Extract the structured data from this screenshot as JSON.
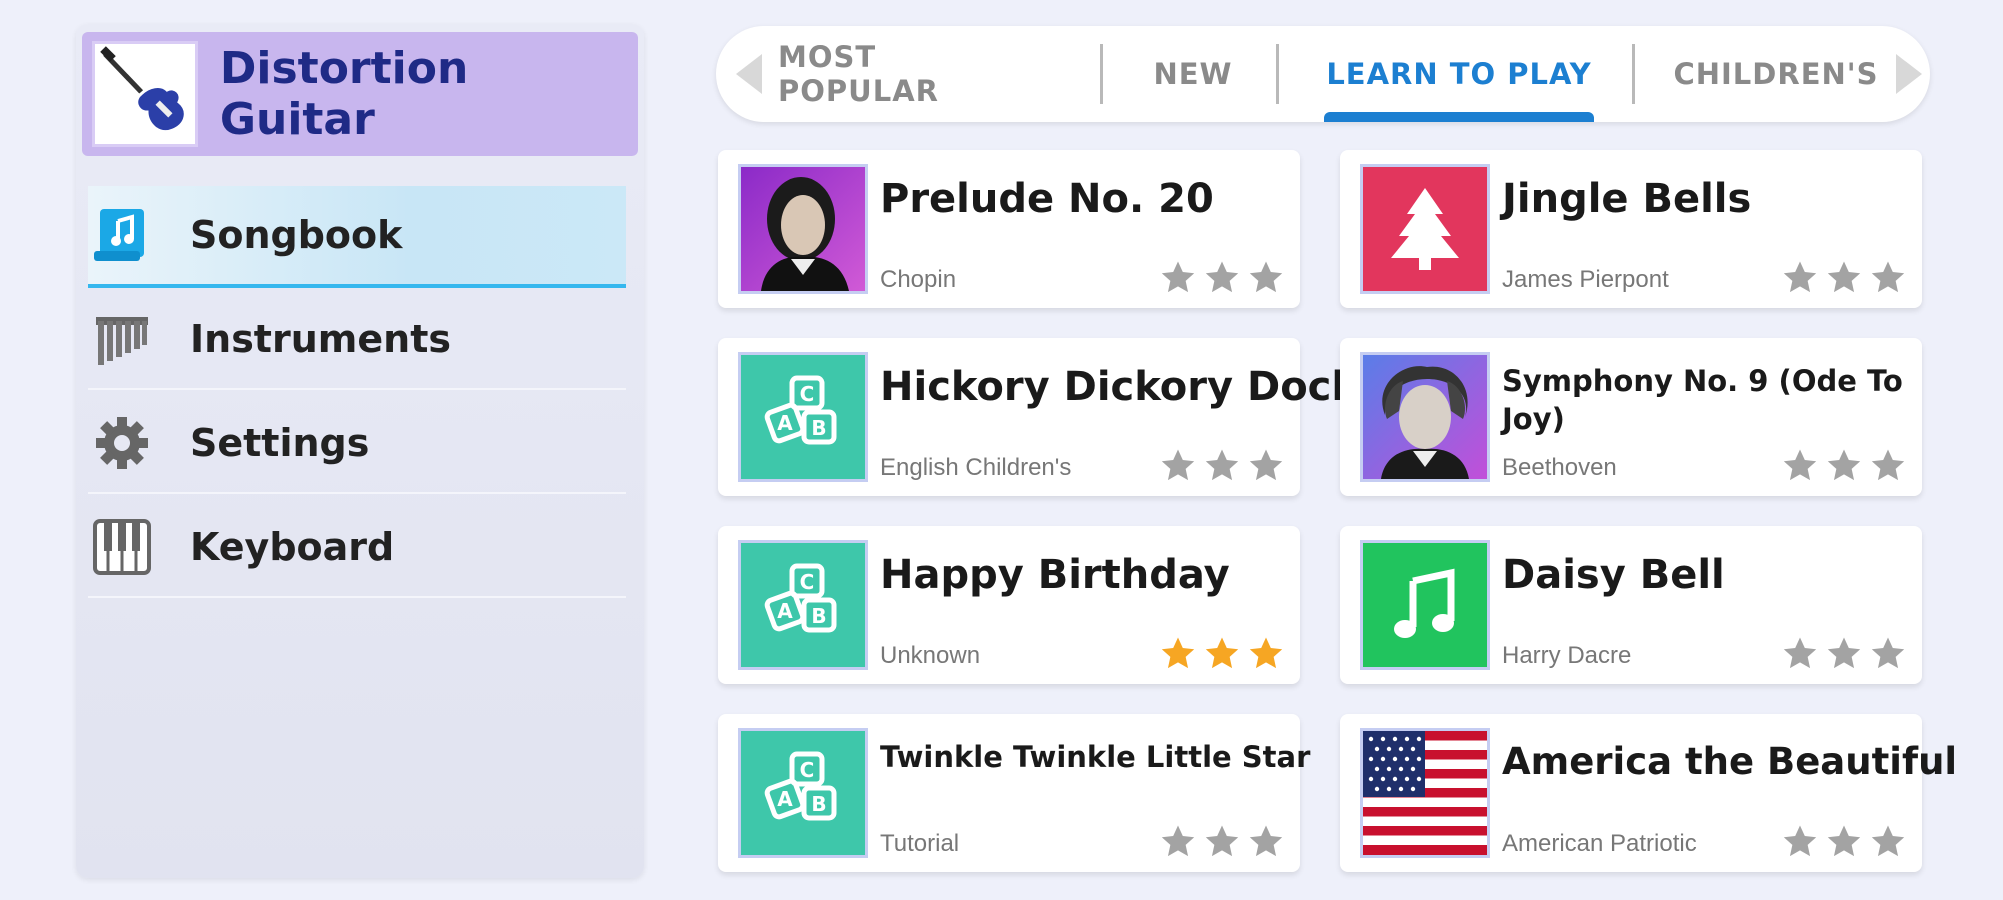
{
  "sidebar": {
    "instrument_title": "Distortion Guitar",
    "items": [
      {
        "label": "Songbook",
        "icon": "songbook-icon",
        "active": true
      },
      {
        "label": "Instruments",
        "icon": "pan-flute-icon",
        "active": false
      },
      {
        "label": "Settings",
        "icon": "gear-icon",
        "active": false
      },
      {
        "label": "Keyboard",
        "icon": "piano-keys-icon",
        "active": false
      }
    ]
  },
  "tabs": [
    {
      "label": "MOST POPULAR",
      "active": false
    },
    {
      "label": "NEW",
      "active": false
    },
    {
      "label": "LEARN TO PLAY",
      "active": true
    },
    {
      "label": "CHILDREN'S",
      "active": false
    }
  ],
  "songs": [
    {
      "title": "Prelude No. 20",
      "artist": "Chopin",
      "thumb": "chopin-portrait",
      "stars_earned": 0,
      "stars_total": 3
    },
    {
      "title": "Jingle Bells",
      "artist": "James Pierpont",
      "thumb": "christmas-tree-icon",
      "stars_earned": 0,
      "stars_total": 3
    },
    {
      "title": "Hickory Dickory Dock",
      "artist": "English Children's",
      "thumb": "abc-blocks-icon",
      "stars_earned": 0,
      "stars_total": 3
    },
    {
      "title": "Symphony No. 9 (Ode To Joy)",
      "artist": "Beethoven",
      "thumb": "beethoven-portrait",
      "stars_earned": 0,
      "stars_total": 3
    },
    {
      "title": "Happy Birthday",
      "artist": "Unknown",
      "thumb": "abc-blocks-icon",
      "stars_earned": 3,
      "stars_total": 3
    },
    {
      "title": "Daisy Bell",
      "artist": "Harry Dacre",
      "thumb": "music-note-icon",
      "stars_earned": 0,
      "stars_total": 3
    },
    {
      "title": "Twinkle Twinkle Little Star",
      "artist": "Tutorial",
      "thumb": "abc-blocks-icon",
      "stars_earned": 0,
      "stars_total": 3
    },
    {
      "title": "America the Beautiful",
      "artist": "American Patriotic",
      "thumb": "us-flag-icon",
      "stars_earned": 0,
      "stars_total": 3
    }
  ],
  "colors": {
    "accent": "#1c7fd1",
    "sidebar_header": "#c8b6ee",
    "star_empty": "#a3a3a3",
    "star_earned": "#f6a623",
    "teal_thumb": "#3ec7aa",
    "red_thumb": "#e2365d",
    "green_thumb": "#21c45e"
  }
}
